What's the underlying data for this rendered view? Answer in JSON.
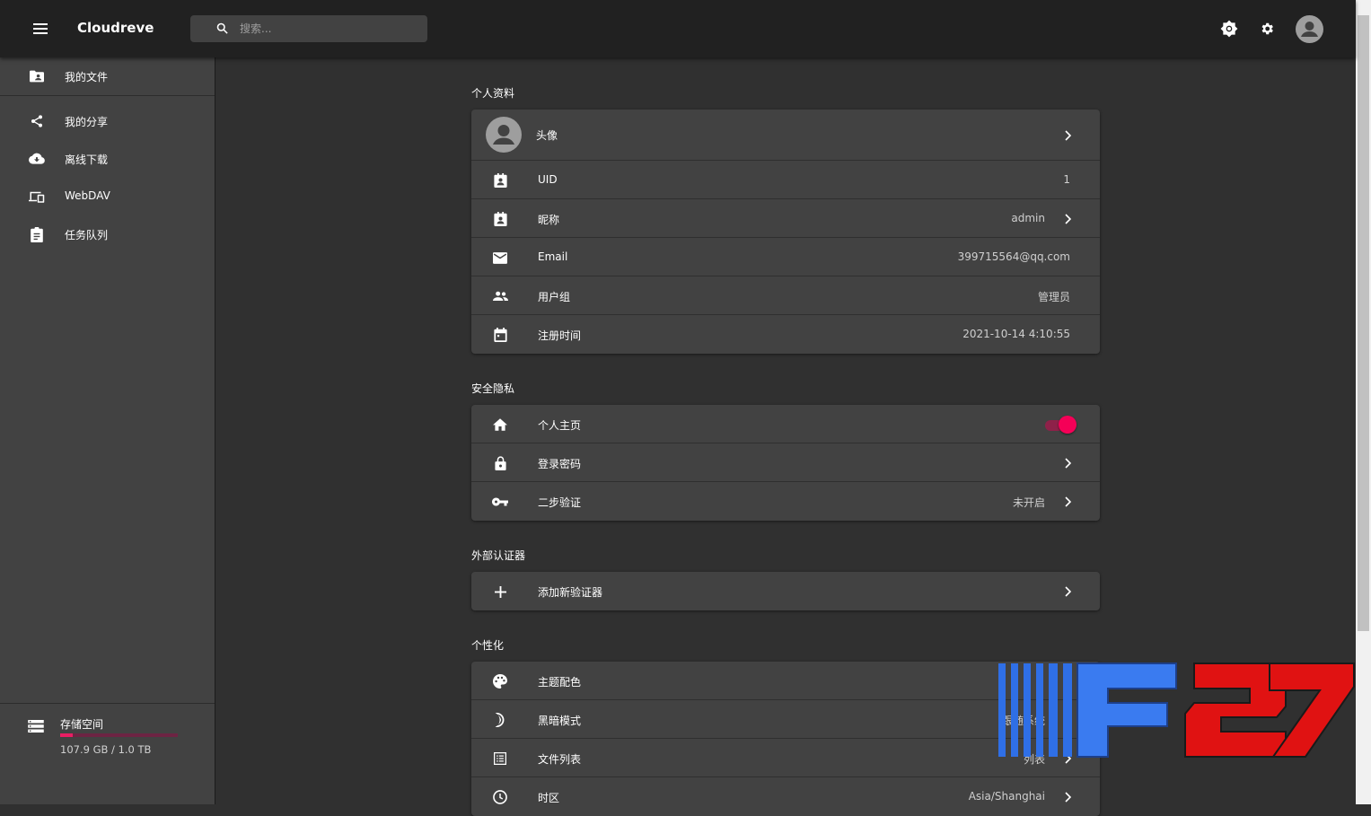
{
  "app": {
    "title": "Cloudreve"
  },
  "search": {
    "placeholder": "搜索..."
  },
  "sidebar": {
    "items": [
      {
        "label": "我的文件",
        "icon": "folder-account-icon"
      },
      {
        "label": "我的分享",
        "icon": "share-icon"
      },
      {
        "label": "离线下载",
        "icon": "cloud-download-icon"
      },
      {
        "label": "WebDAV",
        "icon": "devices-icon"
      },
      {
        "label": "任务队列",
        "icon": "clipboard-list-icon"
      }
    ],
    "storage": {
      "label": "存储空间",
      "value": "107.9 GB / 1.0 TB",
      "used_fraction": 0.105,
      "color": "#e91e63"
    }
  },
  "sections": {
    "profile": {
      "title": "个人资料",
      "avatar_label": "头像",
      "uid": {
        "label": "UID",
        "value": "1"
      },
      "nickname": {
        "label": "昵称",
        "value": "admin"
      },
      "email": {
        "label": "Email",
        "value": "399715564@qq.com"
      },
      "group": {
        "label": "用户组",
        "value": "管理员"
      },
      "registered": {
        "label": "注册时间",
        "value": "2021-10-14 4:10:55"
      }
    },
    "security": {
      "title": "安全隐私",
      "homepage": {
        "label": "个人主页",
        "enabled": true
      },
      "password": {
        "label": "登录密码"
      },
      "twofa": {
        "label": "二步验证",
        "value": "未开启"
      }
    },
    "authenticators": {
      "title": "外部认证器",
      "add": {
        "label": "添加新验证器"
      }
    },
    "personalization": {
      "title": "个性化",
      "theme": {
        "label": "主题配色"
      },
      "dark": {
        "label": "黑暗模式",
        "value": "跟随系统"
      },
      "filelist": {
        "label": "文件列表",
        "value": "列表"
      },
      "timezone": {
        "label": "时区",
        "value": "Asia/Shanghai"
      }
    }
  },
  "watermark": {
    "text": "IIIIF27"
  },
  "colors": {
    "accent": "#f50057",
    "appbar": "#212121",
    "surface": "#424242",
    "background": "#303030"
  }
}
